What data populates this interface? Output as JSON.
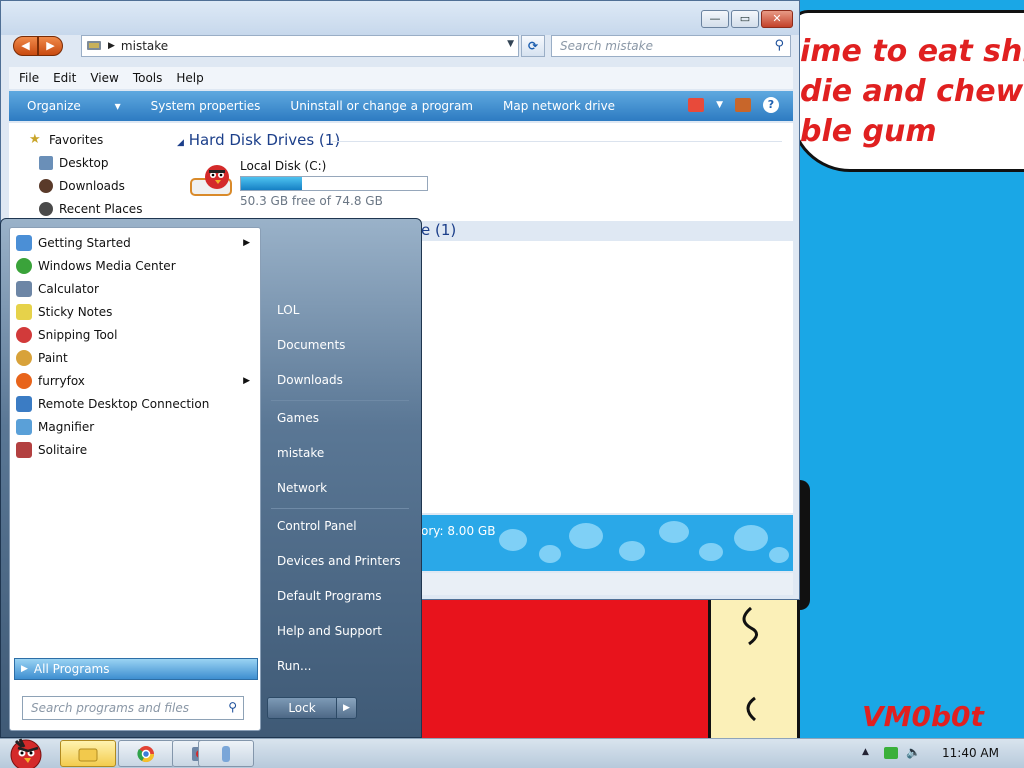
{
  "wallpaper": {
    "line1": "ime to eat shit",
    "line2": "die and chew",
    "line3": "ble gum",
    "signature": "VM0b0t"
  },
  "explorer": {
    "address": "mistake",
    "search_placeholder": "Search mistake",
    "menu": [
      "File",
      "Edit",
      "View",
      "Tools",
      "Help"
    ],
    "commands": [
      "Organize",
      "System properties",
      "Uninstall or change a program",
      "Map network drive"
    ],
    "nav": {
      "favorites": "Favorites",
      "desktop": "Desktop",
      "downloads": "Downloads",
      "recent": "Recent Places"
    },
    "hard_disk_header": "Hard Disk Drives (1)",
    "drive": {
      "name": "Local Disk (C:)",
      "free_text": "50.3 GB free of 74.8 GB",
      "used_fraction": 0.33
    },
    "removable_header": "e (1)",
    "details_text": "ory: 8.00 GB"
  },
  "start_menu": {
    "programs": [
      {
        "label": "Getting Started",
        "arrow": "▶",
        "color": "#4b8fd6"
      },
      {
        "label": "Windows Media Center",
        "arrow": "",
        "color": "#3aa33a"
      },
      {
        "label": "Calculator",
        "arrow": "",
        "color": "#6d86a6"
      },
      {
        "label": "Sticky Notes",
        "arrow": "",
        "color": "#e6d24a"
      },
      {
        "label": "Snipping Tool",
        "arrow": "",
        "color": "#d23a3a"
      },
      {
        "label": "Paint",
        "arrow": "",
        "color": "#d8a23a"
      },
      {
        "label": "furryfox",
        "arrow": "▶",
        "color": "#e8641b"
      },
      {
        "label": "Remote Desktop Connection",
        "arrow": "",
        "color": "#3b7cc4"
      },
      {
        "label": "Magnifier",
        "arrow": "",
        "color": "#5aa0d8"
      },
      {
        "label": "Solitaire",
        "arrow": "",
        "color": "#b34040"
      }
    ],
    "all_programs": "All Programs",
    "search_placeholder": "Search programs and files",
    "right": {
      "lol": "LOL",
      "documents": "Documents",
      "downloads": "Downloads",
      "games": "Games",
      "mistake": "mistake",
      "network": "Network",
      "control_panel": "Control Panel",
      "devices": "Devices and Printers",
      "defaults": "Default Programs",
      "help": "Help and Support",
      "run": "Run..."
    },
    "lock": "Lock"
  },
  "taskbar": {
    "clock": "11:40 AM"
  }
}
